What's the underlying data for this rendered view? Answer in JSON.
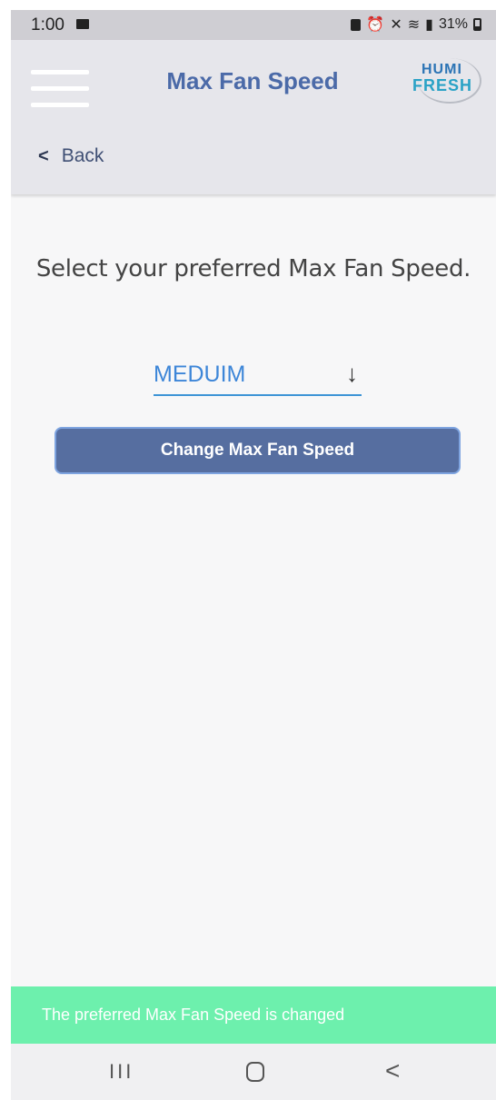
{
  "status_bar": {
    "time": "1:00",
    "battery": "31%",
    "icons": [
      "image-icon",
      "lock-icon",
      "alarm-icon",
      "mute-icon",
      "wifi-icon",
      "signal-icon",
      "battery-icon"
    ]
  },
  "header": {
    "title": "Max Fan Speed",
    "back_label": "Back",
    "logo_top": "HUMI",
    "logo_bottom": "FRESH"
  },
  "content": {
    "prompt": "Select your preferred Max Fan Speed.",
    "selected_speed": "MEDUIM",
    "button_label": "Change Max Fan Speed"
  },
  "toast": {
    "message": "The preferred Max Fan Speed is changed"
  },
  "nav_bar": {
    "recents_glyph": "III",
    "back_glyph": "<"
  },
  "colors": {
    "accent": "#4b6aa8",
    "button": "#566ea0",
    "select_value": "#3d86d8",
    "toast": "#6df0ad",
    "header_bg": "#e6e6eb"
  }
}
